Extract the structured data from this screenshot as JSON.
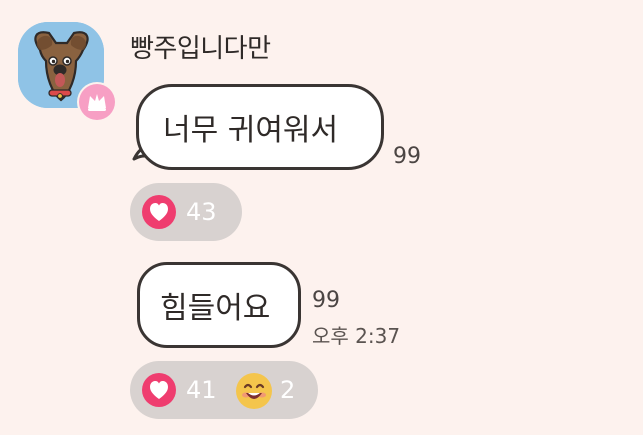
{
  "chat": {
    "sender_name": "빵주입니다만",
    "messages": [
      {
        "text": "너무 귀여워서",
        "unread_count": "99",
        "reactions": [
          {
            "icon": "heart-icon",
            "count": "43"
          }
        ]
      },
      {
        "text": "힘들어요",
        "unread_count": "99",
        "timestamp": "오후 2:37",
        "reactions": [
          {
            "icon": "heart-icon",
            "count": "41"
          },
          {
            "icon": "smile-icon",
            "count": "2"
          }
        ]
      }
    ]
  },
  "colors": {
    "background": "#fdf2ee",
    "bubble": "#ffffff",
    "bubble_border": "#3a3533",
    "reaction_bar": "#d8d2d0",
    "heart": "#ef3d6f",
    "crown_badge": "#f79fc4",
    "avatar_background": "#8fc3e6"
  }
}
